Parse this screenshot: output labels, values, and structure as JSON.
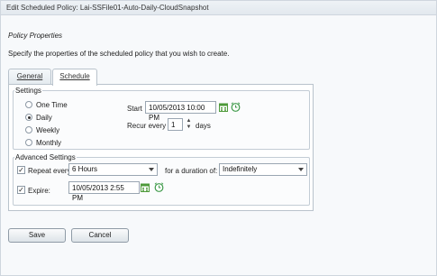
{
  "window": {
    "title": "Edit Scheduled Policy: Lai-SSFile01-Auto-Daily-CloudSnapshot"
  },
  "page": {
    "heading": "Policy Properties",
    "description": "Specify the properties of the scheduled policy that you wish to create."
  },
  "tabs": [
    {
      "label": "General",
      "active": false
    },
    {
      "label": "Schedule",
      "active": true
    }
  ],
  "settings": {
    "group_label": "Settings",
    "frequency_options": [
      "One Time",
      "Daily",
      "Weekly",
      "Monthly"
    ],
    "selected_frequency": "Daily",
    "start_label": "Start",
    "start_value": "10/05/2013 10:00 PM",
    "recur_label": "Recur every",
    "recur_value": "1",
    "recur_unit": "days"
  },
  "advanced": {
    "group_label": "Advanced Settings",
    "repeat_label": "Repeat every:",
    "repeat_checked": true,
    "repeat_value": "6 Hours",
    "duration_label": "for a duration of:",
    "duration_value": "Indefinitely",
    "expire_label": "Expire:",
    "expire_checked": true,
    "expire_value": "10/05/2013 2:55 PM"
  },
  "buttons": {
    "save": "Save",
    "cancel": "Cancel"
  },
  "colors": {
    "calendar_icon": "#4e9a3a",
    "clock_icon": "#3e9a4a",
    "border": "#b9c3cc"
  }
}
